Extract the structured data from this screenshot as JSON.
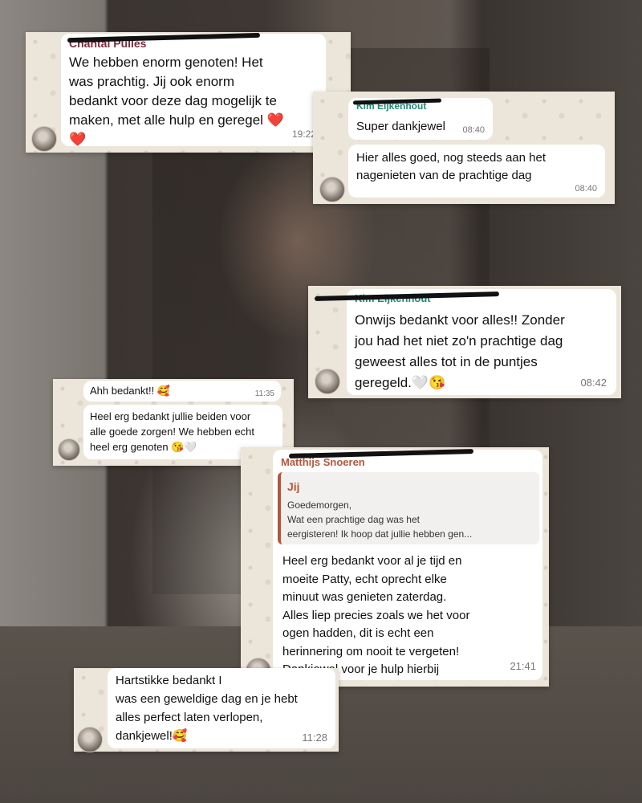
{
  "screenshots": [
    {
      "sender": "Chantal Pulles",
      "messages": [
        {
          "text": "We hebben enorm genoten! Het\nwas prachtig. Jij ook enorm\nbedankt voor deze dag mogelijk te\nmaken, met alle hulp en geregel ❤️\n❤️",
          "time": "19:22"
        }
      ]
    },
    {
      "sender": "Kim Eijkenhout",
      "messages": [
        {
          "text": "Super dankjewel",
          "time": "08:40"
        },
        {
          "text": "Hier alles goed, nog steeds aan het\nnagenieten van de prachtige dag",
          "time": "08:40"
        }
      ]
    },
    {
      "sender": "Kim Eijkenhout",
      "messages": [
        {
          "text": "Onwijs bedankt voor alles!! Zonder\njou had het niet zo'n prachtige dag\ngeweest alles tot in de puntjes\ngeregeld.🤍😘",
          "time": "08:42"
        }
      ]
    },
    {
      "sender": "",
      "messages": [
        {
          "text": "Ahh bedankt!! 🥰",
          "time": "11:35"
        },
        {
          "text": "Heel erg bedankt jullie beiden voor\nalle goede zorgen! We hebben echt\nheel erg genoten 😘🤍",
          "time": ""
        }
      ]
    },
    {
      "sender": "Matthijs Snoeren",
      "quote": {
        "name": "Jij",
        "text": "Goedemorgen,\nWat een prachtige dag was het\neergisteren! Ik hoop dat jullie hebben gen..."
      },
      "messages": [
        {
          "text": "Heel erg bedankt voor al je tijd en\nmoeite Patty, echt oprecht elke\nminuut was genieten zaterdag.\nAlles liep precies zoals we het voor\nogen hadden, dit is echt een\nherinnering om nooit te vergeten!\nDankjewel voor je hulp hierbij",
          "time": "21:41"
        }
      ]
    },
    {
      "sender": "",
      "messages": [
        {
          "text": "Hartstikke bedankt I\nwas een geweldige dag en je hebt\nalles perfect laten verlopen,\ndankjewel!🥰",
          "time": "11:28"
        }
      ]
    }
  ],
  "colors": {
    "card_bg": "#ece6da",
    "bubble_bg": "#ffffff",
    "sender_1": "#7c2a3a",
    "sender_2": "#1f8a75",
    "sender_3": "#b7553a",
    "timestamp": "#777777"
  }
}
